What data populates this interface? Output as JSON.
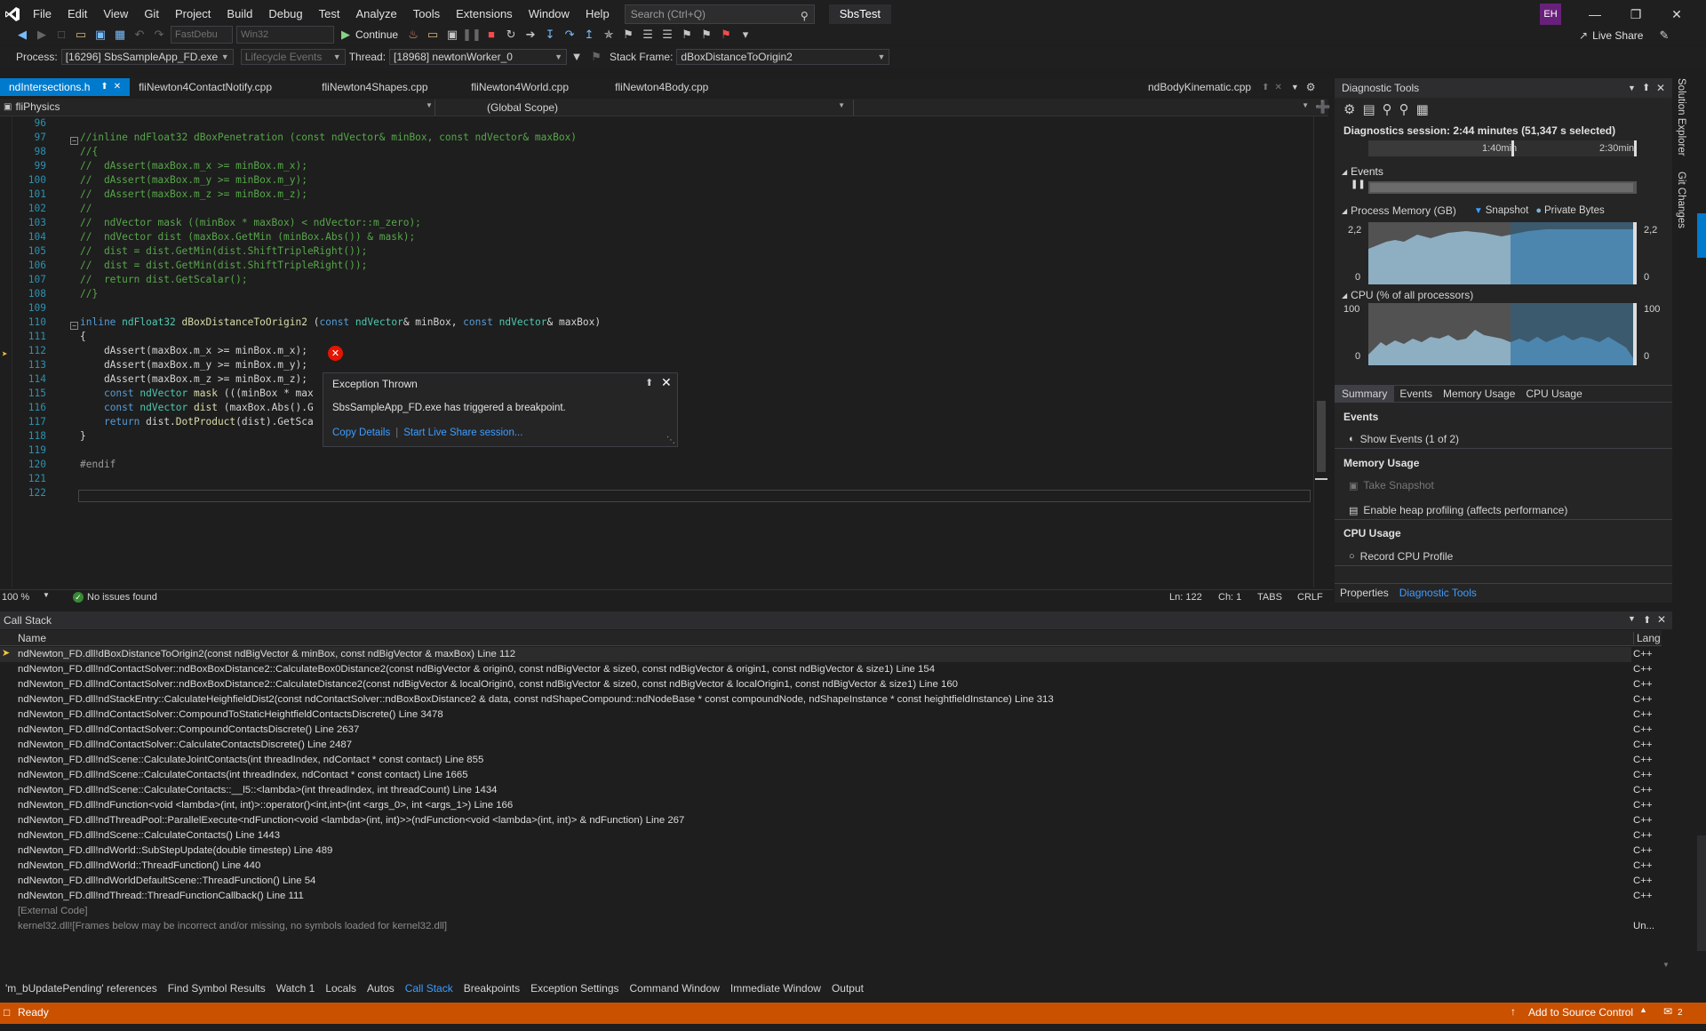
{
  "menu": [
    "File",
    "Edit",
    "View",
    "Git",
    "Project",
    "Build",
    "Debug",
    "Test",
    "Analyze",
    "Tools",
    "Extensions",
    "Window",
    "Help"
  ],
  "search_placeholder": "Search (Ctrl+Q)",
  "solution_name": "SbsTest",
  "avatar_initials": "EH",
  "toolbar": {
    "config": "FastDebu",
    "platform": "Win32",
    "continue_label": "Continue",
    "live_share": "Live Share"
  },
  "debug_location": {
    "process_label": "Process:",
    "process": "[16296] SbsSampleApp_FD.exe",
    "lifecycle": "Lifecycle Events",
    "thread_label": "Thread:",
    "thread": "[18968] newtonWorker_0",
    "stackframe_label": "Stack Frame:",
    "stackframe": "dBoxDistanceToOrigin2"
  },
  "tabs": [
    "ndIntersections.h",
    "fliNewton4ContactNotify.cpp",
    "fliNewton4Shapes.cpp",
    "fliNewton4World.cpp",
    "fliNewton4Body.cpp"
  ],
  "right_tab": "ndBodyKinematic.cpp",
  "nav": {
    "project": "fliPhysics",
    "scope": "(Global Scope)"
  },
  "code_lines": [
    {
      "n": "96",
      "t": "",
      "c": ""
    },
    {
      "n": "97",
      "t": "//inline ndFloat32 dBoxPenetration (const ndVector& minBox, const ndVector& maxBox)",
      "c": "cmt"
    },
    {
      "n": "98",
      "t": "//{",
      "c": "cmt"
    },
    {
      "n": "99",
      "t": "//  dAssert(maxBox.m_x >= minBox.m_x);",
      "c": "cmt"
    },
    {
      "n": "100",
      "t": "//  dAssert(maxBox.m_y >= minBox.m_y);",
      "c": "cmt"
    },
    {
      "n": "101",
      "t": "//  dAssert(maxBox.m_z >= minBox.m_z);",
      "c": "cmt"
    },
    {
      "n": "102",
      "t": "//",
      "c": "cmt"
    },
    {
      "n": "103",
      "t": "//  ndVector mask ((minBox * maxBox) < ndVector::m_zero);",
      "c": "cmt"
    },
    {
      "n": "104",
      "t": "//  ndVector dist (maxBox.GetMin (minBox.Abs()) & mask);",
      "c": "cmt"
    },
    {
      "n": "105",
      "t": "//  dist = dist.GetMin(dist.ShiftTripleRight());",
      "c": "cmt"
    },
    {
      "n": "106",
      "t": "//  dist = dist.GetMin(dist.ShiftTripleRight());",
      "c": "cmt"
    },
    {
      "n": "107",
      "t": "//  return dist.GetScalar();",
      "c": "cmt"
    },
    {
      "n": "108",
      "t": "//}",
      "c": "cmt"
    },
    {
      "n": "109",
      "t": "",
      "c": ""
    },
    {
      "n": "110",
      "t": "",
      "c": "sig"
    },
    {
      "n": "111",
      "t": "{",
      "c": ""
    },
    {
      "n": "112",
      "t": "    dAssert(maxBox.m_x >= minBox.m_x);",
      "c": ""
    },
    {
      "n": "113",
      "t": "    dAssert(maxBox.m_y >= minBox.m_y);",
      "c": ""
    },
    {
      "n": "114",
      "t": "    dAssert(maxBox.m_z >= minBox.m_z);",
      "c": ""
    },
    {
      "n": "115",
      "t": "",
      "c": "l115"
    },
    {
      "n": "116",
      "t": "",
      "c": "l116"
    },
    {
      "n": "117",
      "t": "",
      "c": "l117"
    },
    {
      "n": "118",
      "t": "}",
      "c": ""
    },
    {
      "n": "119",
      "t": "",
      "c": ""
    },
    {
      "n": "120",
      "t": "#endif",
      "c": "pp"
    },
    {
      "n": "121",
      "t": "",
      "c": ""
    },
    {
      "n": "122",
      "t": "",
      "c": ""
    }
  ],
  "exception": {
    "title": "Exception Thrown",
    "message": "SbsSampleApp_FD.exe has triggered a breakpoint.",
    "copy_details": "Copy Details",
    "live_share": "Start Live Share session..."
  },
  "editor_footer": {
    "zoom": "100 %",
    "issues": "No issues found",
    "ln": "Ln: 122",
    "ch": "Ch: 1",
    "tabs": "TABS",
    "crlf": "CRLF"
  },
  "diagnostics": {
    "title": "Diagnostic Tools",
    "session": "Diagnostics session: 2:44 minutes (51,347 s selected)",
    "time1": "1:40min",
    "time2": "2:30min",
    "events_label": "Events",
    "memory_label": "Process Memory (GB)",
    "snapshot_legend": "Snapshot",
    "private_bytes_legend": "Private Bytes",
    "mem_max": "2,2",
    "mem_min": "0",
    "cpu_label": "CPU (% of all processors)",
    "cpu_max": "100",
    "cpu_min": "0",
    "tabs": [
      "Summary",
      "Events",
      "Memory Usage",
      "CPU Usage"
    ],
    "events_heading": "Events",
    "show_events": "Show Events (1 of 2)",
    "memory_heading": "Memory Usage",
    "take_snapshot": "Take Snapshot",
    "enable_heap": "Enable heap profiling (affects performance)",
    "cpu_heading": "CPU Usage",
    "record_cpu": "Record CPU Profile",
    "bottom_tabs": [
      "Properties",
      "Diagnostic Tools"
    ]
  },
  "side_tabs": [
    "Solution Explorer",
    "Git Changes"
  ],
  "callstack": {
    "title": "Call Stack",
    "col_name": "Name",
    "col_lang": "Lang",
    "rows": [
      {
        "name": "ndNewton_FD.dll!dBoxDistanceToOrigin2(const ndBigVector & minBox, const ndBigVector & maxBox) Line 112",
        "lang": "C++"
      },
      {
        "name": "ndNewton_FD.dll!ndContactSolver::ndBoxBoxDistance2::CalculateBox0Distance2(const ndBigVector & origin0, const ndBigVector & size0, const ndBigVector & origin1, const ndBigVector & size1) Line 154",
        "lang": "C++"
      },
      {
        "name": "ndNewton_FD.dll!ndContactSolver::ndBoxBoxDistance2::CalculateDistance2(const ndBigVector & localOrigin0, const ndBigVector & size0, const ndBigVector & localOrigin1, const ndBigVector & size1) Line 160",
        "lang": "C++"
      },
      {
        "name": "ndNewton_FD.dll!ndStackEntry::CalculateHeighfieldDist2(const ndContactSolver::ndBoxBoxDistance2 & data, const ndShapeCompound::ndNodeBase * const compoundNode, ndShapeInstance * const heightfieldInstance) Line 313",
        "lang": "C++"
      },
      {
        "name": "ndNewton_FD.dll!ndContactSolver::CompoundToStaticHeightfieldContactsDiscrete() Line 3478",
        "lang": "C++"
      },
      {
        "name": "ndNewton_FD.dll!ndContactSolver::CompoundContactsDiscrete() Line 2637",
        "lang": "C++"
      },
      {
        "name": "ndNewton_FD.dll!ndContactSolver::CalculateContactsDiscrete() Line 2487",
        "lang": "C++"
      },
      {
        "name": "ndNewton_FD.dll!ndScene::CalculateJointContacts(int threadIndex, ndContact * const contact) Line 855",
        "lang": "C++"
      },
      {
        "name": "ndNewton_FD.dll!ndScene::CalculateContacts(int threadIndex, ndContact * const contact) Line 1665",
        "lang": "C++"
      },
      {
        "name": "ndNewton_FD.dll!ndScene::CalculateContacts::__l5::<lambda>(int threadIndex, int threadCount) Line 1434",
        "lang": "C++"
      },
      {
        "name": "ndNewton_FD.dll!ndFunction<void <lambda>(int, int)>::operator()<int,int>(int <args_0>, int <args_1>) Line 166",
        "lang": "C++"
      },
      {
        "name": "ndNewton_FD.dll!ndThreadPool::ParallelExecute<ndFunction<void <lambda>(int, int)>>(ndFunction<void <lambda>(int, int)> & ndFunction) Line 267",
        "lang": "C++"
      },
      {
        "name": "ndNewton_FD.dll!ndScene::CalculateContacts() Line 1443",
        "lang": "C++"
      },
      {
        "name": "ndNewton_FD.dll!ndWorld::SubStepUpdate(double timestep) Line 489",
        "lang": "C++"
      },
      {
        "name": "ndNewton_FD.dll!ndWorld::ThreadFunction() Line 440",
        "lang": "C++"
      },
      {
        "name": "ndNewton_FD.dll!ndWorldDefaultScene::ThreadFunction() Line 54",
        "lang": "C++"
      },
      {
        "name": "ndNewton_FD.dll!ndThread::ThreadFunctionCallback() Line 111",
        "lang": "C++"
      },
      {
        "name": "[External Code]",
        "lang": ""
      },
      {
        "name": "kernel32.dll![Frames below may be incorrect and/or missing, no symbols loaded for kernel32.dll]",
        "lang": "Un..."
      }
    ]
  },
  "bottom_tabs": [
    "'m_bUpdatePending' references",
    "Find Symbol Results",
    "Watch 1",
    "Locals",
    "Autos",
    "Call Stack",
    "Breakpoints",
    "Exception Settings",
    "Command Window",
    "Immediate Window",
    "Output"
  ],
  "bottom_tabs_active": "Call Stack",
  "status": {
    "ready": "Ready",
    "source_control": "Add to Source Control",
    "notifications": "2"
  },
  "colors": {
    "accent": "#007acc",
    "status_bar": "#ca5100",
    "link": "#3e9dff",
    "error": "#e51400"
  }
}
